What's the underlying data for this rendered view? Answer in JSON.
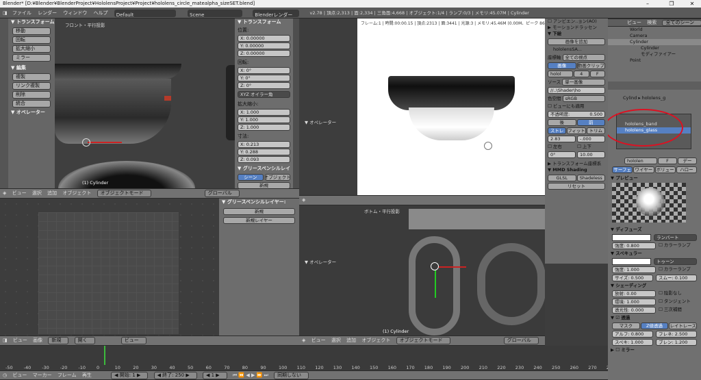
{
  "window": {
    "title": "Blender* [D:¥Blender¥BlenderProject¥HololensProject¥Project¥hololens_circle_matealpha_sizeSET.blend]"
  },
  "menu": {
    "items": [
      "ファイル",
      "レンダー",
      "ウィンドウ",
      "ヘルプ"
    ],
    "layout": "Default",
    "scene": "Scene",
    "engine": "Blenderレンダー",
    "stats": "v2.78 | 頂点:2,313 | 面:2,334 | 三角面:4,668 | オブジェクト:1/4 | ランプ:0/3 | メモリ:45.07M | Cylinder"
  },
  "tl_view": {
    "title": "フロント・平行投影",
    "object_label": "(1) Cylinder"
  },
  "toolshelf": {
    "transform_title": "▼ トランスフォーム",
    "transform_btns": [
      "移動",
      "回転",
      "拡大縮小",
      "ミラー"
    ],
    "edit_title": "▼ 編集",
    "edit_btns": [
      "複製",
      "リンク複製",
      "削除",
      "統合"
    ],
    "operator_title": "▼ オペレーター"
  },
  "npanel": {
    "title": "▼ トランスフォーム",
    "location_label": "位置:",
    "location": [
      "X:  0.00000",
      "Y:  0.00000",
      "Z:  0.00000"
    ],
    "rotation_label": "回転:",
    "rotation": [
      "X:  0°",
      "Y:  0°",
      "Z:  0°"
    ],
    "rotation_mode": "XYZ オイラー角",
    "scale_label": "拡大縮小:",
    "scale": [
      "X:  1.000",
      "Y:  1.000",
      "Z:  1.000"
    ],
    "dim_label": "寸法:",
    "dims": [
      "X:  0.213",
      "Y:  0.288",
      "Z:  0.093"
    ],
    "gp_title": "▼ グリースペンシルレイ",
    "gp_tabs": [
      "シーン",
      "オブジェクト"
    ],
    "gp_new": "新規"
  },
  "tl_header": {
    "items": [
      "ビュー",
      "選択",
      "追加",
      "オブジェクト"
    ],
    "mode": "オブジェクトモード",
    "orient": "グローバル"
  },
  "bl_panel": {
    "title": "▼ グリースペンシルレイヤー:",
    "new": "新規",
    "new_layer": "新規レイヤー"
  },
  "render_view": {
    "info": "フレーム:1 | 時間:00:00.15 | 頂点:2313 | 面:3441 | 光源:3 | メモリ:45.46M (0.00M、ピーク 86.36M)",
    "operator": "▼ オペレーター"
  },
  "render_panel": {
    "ao": "アンビエン..ョン(AO)",
    "motion": "▶ モーションドラッセン",
    "shade_title": "▼ 下絵",
    "add_image": "画像を追加",
    "img_name": "hololensSA...",
    "axis_label": "座標軸",
    "axis_val": "全ての視点",
    "tabs": [
      "画像",
      "動画クリップ"
    ],
    "img_field": "holol",
    "img_num": "4",
    "img_f": "F",
    "source_label": "ソース",
    "source_val": "単一画像",
    "path": "//..\\Shader\\ho",
    "colorspace_label": "色空間",
    "colorspace": "sRGB",
    "viewcheck": "ビューにも適用",
    "opacity_label": "不透明度:",
    "opacity": "0.500",
    "back": "後",
    "front": "前",
    "stretch": [
      "ストレ",
      "フィット",
      "トリム"
    ],
    "size": "2.83",
    "angle": "-.000",
    "lr": "左右",
    "ud": "上下",
    "rot1": "0°",
    "rot2": "10.00",
    "transform": "▶ トランスフォーム座標系",
    "mmd_title": "▼ MMD Shading",
    "glsl": "GLSL",
    "shadeless": "Shadeless",
    "reset": "リセット"
  },
  "br_view": {
    "title": "ボトム・平行投影",
    "operator": "▼ オペレーター",
    "object_label": "(1) Cylinder"
  },
  "br_header": {
    "items": [
      "ビュー",
      "選択",
      "追加",
      "オブジェクト"
    ],
    "mode": "オブジェクトモード",
    "orient": "グローバル"
  },
  "outliner": {
    "header": [
      "ビュー",
      "検索",
      "全てのシーン"
    ],
    "rows": [
      "World",
      "Camera",
      "Cylinder",
      "Cylinder",
      "モディファイアー",
      "Point"
    ]
  },
  "props": {
    "breadcrumb": [
      "Cylind",
      "hololens_g"
    ],
    "materials": [
      "hololens_band",
      "hololens_glass"
    ],
    "mat_name": "hololen",
    "mat_f": "F",
    "data_btn": "デー",
    "tabs": [
      "サーフェ",
      "ワイヤー",
      "ボリュー",
      "ハロー"
    ],
    "preview": "▼ プレビュー",
    "diffuse": "▼ ディフューズ",
    "diffuse_shader": "ランバート",
    "diffuse_intensity": "強度:  0.800",
    "ramp": "カラーランプ",
    "specular": "▼ スペキュラー",
    "spec_shader": "トゥーン",
    "spec_intensity": "強度:  1.000",
    "spec_size": "サイズ: 0.500",
    "spec_smooth": "スムー: 0.100",
    "shading": "▼ シェーディング",
    "emit": "放射:  0.00",
    "shadeless": "陰影なし",
    "ambient": "環境:  1.000",
    "tangent": "タンジェント",
    "translucency": "透光性: 0.000",
    "cubic": "三次補間",
    "transparency": "▼ ☑ 透過",
    "transp_tabs": [
      "マスク",
      "Z値透過",
      "レイトレース"
    ],
    "alpha": "アルフ: 0.800",
    "fresnel": "フレネ: 2.500",
    "spec_t": "スペキ: 1.000",
    "blend": "ブレン: 1.200",
    "mirror": "▶ ☐ ミラー"
  },
  "timeline_header": {
    "items": [
      "ビュー",
      "画像"
    ],
    "new": "新規",
    "open": "開く",
    "view": "ビュー"
  },
  "timeline": {
    "ticks": [
      "-50",
      "-40",
      "-30",
      "-20",
      "-10",
      "0",
      "10",
      "20",
      "30",
      "40",
      "50",
      "60",
      "70",
      "80",
      "90",
      "100",
      "110",
      "120",
      "130",
      "140",
      "150",
      "160",
      "170",
      "180",
      "190",
      "200",
      "210",
      "220",
      "230",
      "240",
      "250",
      "260",
      "270",
      "280"
    ]
  },
  "bottombar": {
    "items": [
      "ビュー",
      "マーカー",
      "フレーム",
      "再生"
    ],
    "start": "◀ 開始:     1 ▶",
    "end": "◀ 終了:   250 ▶",
    "frame": "◀    1 ▶",
    "sync": "同期しない"
  }
}
